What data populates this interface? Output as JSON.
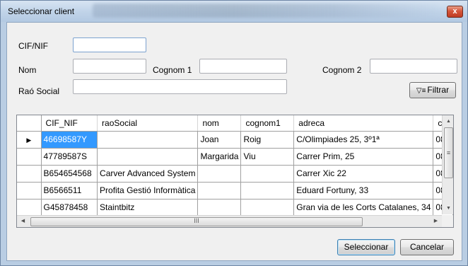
{
  "window": {
    "title": "Seleccionar client",
    "close_glyph": "x"
  },
  "form": {
    "cif_label": "CIF/NIF",
    "cif_value": "",
    "nom_label": "Nom",
    "nom_value": "",
    "cognom1_label": "Cognom 1",
    "cognom1_value": "",
    "cognom2_label": "Cognom 2",
    "cognom2_value": "",
    "rao_label": "Raó Social",
    "rao_value": "",
    "filter_button": "Filtrar",
    "filter_icon": "filter-icon"
  },
  "grid": {
    "columns": [
      "CIF_NIF",
      "raoSocial",
      "nom",
      "cognom1",
      "adreca",
      "c"
    ],
    "current_row_marker": "▶",
    "rows": [
      [
        "46698587Y",
        "",
        "Joan",
        "Roig",
        "C/Olimpiades 25, 3º1ª",
        "08"
      ],
      [
        "47789587S",
        "",
        "Margarida",
        "Viu",
        "Carrer Prim, 25",
        "08"
      ],
      [
        "B654654568",
        "Carver Advanced System",
        "",
        "",
        "Carrer Xic 22",
        "08"
      ],
      [
        "B6566511",
        "Profita Gestió Informàtica",
        "",
        "",
        "Eduard Fortuny, 33",
        "08"
      ],
      [
        "G45878458",
        "Staintbitz",
        "",
        "",
        "Gran via de les Corts Catalanes, 34",
        "08"
      ]
    ]
  },
  "buttons": {
    "select": "Seleccionar",
    "cancel": "Cancelar"
  },
  "colors": {
    "selection": "#3399ff",
    "titlebar": "#c1d4e9",
    "close": "#c8432a"
  }
}
